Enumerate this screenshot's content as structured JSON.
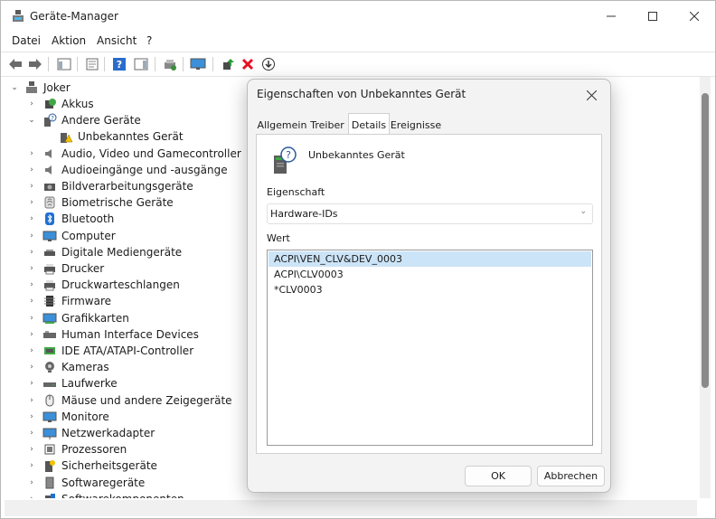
{
  "window": {
    "title": "Geräte-Manager"
  },
  "menu": [
    "Datei",
    "Aktion",
    "Ansicht",
    "?"
  ],
  "toolbar": {
    "buttons": [
      "back-icon",
      "forward-icon",
      "show-hide-console-tree-icon",
      "properties-icon",
      "help-icon",
      "action-pane-icon",
      "scan-hardware-icon",
      "display-icon",
      "update-driver-icon",
      "uninstall-icon",
      "disable-device-icon"
    ]
  },
  "tree": {
    "root": "Joker",
    "items": [
      {
        "label": "Akkus",
        "icon": "battery-icon"
      },
      {
        "label": "Andere Geräte",
        "icon": "unknown-device-icon",
        "expanded": true
      },
      {
        "label": "Unbekanntes Gerät",
        "icon": "warning-device-icon",
        "child": true
      },
      {
        "label": "Audio, Video und Gamecontroller",
        "icon": "speaker-icon"
      },
      {
        "label": "Audioeingänge und -ausgänge",
        "icon": "speaker-icon"
      },
      {
        "label": "Bildverarbeitungsgeräte",
        "icon": "camera-icon"
      },
      {
        "label": "Biometrische Geräte",
        "icon": "fingerprint-icon"
      },
      {
        "label": "Bluetooth",
        "icon": "bluetooth-icon"
      },
      {
        "label": "Computer",
        "icon": "monitor-icon"
      },
      {
        "label": "Digitale Mediengeräte",
        "icon": "media-device-icon"
      },
      {
        "label": "Drucker",
        "icon": "printer-icon"
      },
      {
        "label": "Druckwarteschlangen",
        "icon": "printer-icon"
      },
      {
        "label": "Firmware",
        "icon": "firmware-icon"
      },
      {
        "label": "Grafikkarten",
        "icon": "display-adapter-icon"
      },
      {
        "label": "Human Interface Devices",
        "icon": "hid-icon"
      },
      {
        "label": "IDE ATA/ATAPI-Controller",
        "icon": "ide-controller-icon"
      },
      {
        "label": "Kameras",
        "icon": "webcam-icon"
      },
      {
        "label": "Laufwerke",
        "icon": "disk-drive-icon"
      },
      {
        "label": "Mäuse und andere Zeigegeräte",
        "icon": "mouse-icon"
      },
      {
        "label": "Monitore",
        "icon": "monitor-icon"
      },
      {
        "label": "Netzwerkadapter",
        "icon": "network-adapter-icon"
      },
      {
        "label": "Prozessoren",
        "icon": "processor-icon"
      },
      {
        "label": "Sicherheitsgeräte",
        "icon": "security-device-icon"
      },
      {
        "label": "Softwaregeräte",
        "icon": "software-device-icon"
      },
      {
        "label": "Softwarekomponenten",
        "icon": "software-component-icon"
      }
    ]
  },
  "dialog": {
    "title": "Eigenschaften von Unbekanntes Gerät",
    "tabs": [
      "Allgemein",
      "Treiber",
      "Details",
      "Ereignisse"
    ],
    "active_tab": "Details",
    "device_name": "Unbekanntes Gerät",
    "property_label": "Eigenschaft",
    "property_value": "Hardware-IDs",
    "value_label": "Wert",
    "values": [
      "ACPI\\VEN_CLV&DEV_0003",
      "ACPI\\CLV0003",
      "*CLV0003"
    ],
    "selected_value_index": 0,
    "ok_label": "OK",
    "cancel_label": "Abbrechen"
  },
  "colors": {
    "selection": "#cce4f7",
    "accent": "#0067c0",
    "uninstall": "#e81123"
  }
}
